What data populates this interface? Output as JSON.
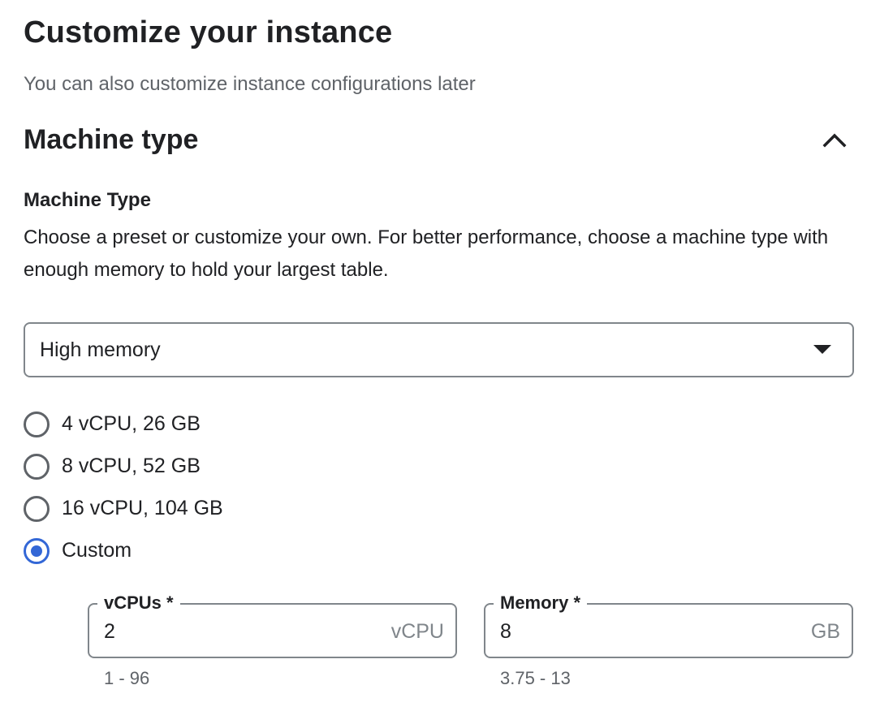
{
  "page": {
    "title": "Customize your instance",
    "subtitle": "You can also customize instance configurations later"
  },
  "section": {
    "title": "Machine type",
    "expanded": true,
    "toggle_icon": "chevron-up-icon"
  },
  "machine_type": {
    "label": "Machine Type",
    "description": "Choose a preset or customize your own. For better performance, choose a machine type with enough memory to hold your largest table.",
    "select": {
      "selected": "High memory",
      "icon": "dropdown-arrow-icon"
    },
    "options": [
      {
        "label": "4 vCPU, 26 GB",
        "checked": false
      },
      {
        "label": "8 vCPU, 52 GB",
        "checked": false
      },
      {
        "label": "16 vCPU, 104 GB",
        "checked": false
      },
      {
        "label": "Custom",
        "checked": true
      }
    ]
  },
  "custom": {
    "vcpus": {
      "label": "vCPUs *",
      "value": "2",
      "suffix": "vCPU",
      "hint": "1 - 96"
    },
    "memory": {
      "label": "Memory *",
      "value": "8",
      "suffix": "GB",
      "hint": "3.75 - 13"
    }
  },
  "colors": {
    "accent": "#3367d6",
    "text": "#202124",
    "secondary_text": "#5f6368",
    "border": "#80868b"
  }
}
